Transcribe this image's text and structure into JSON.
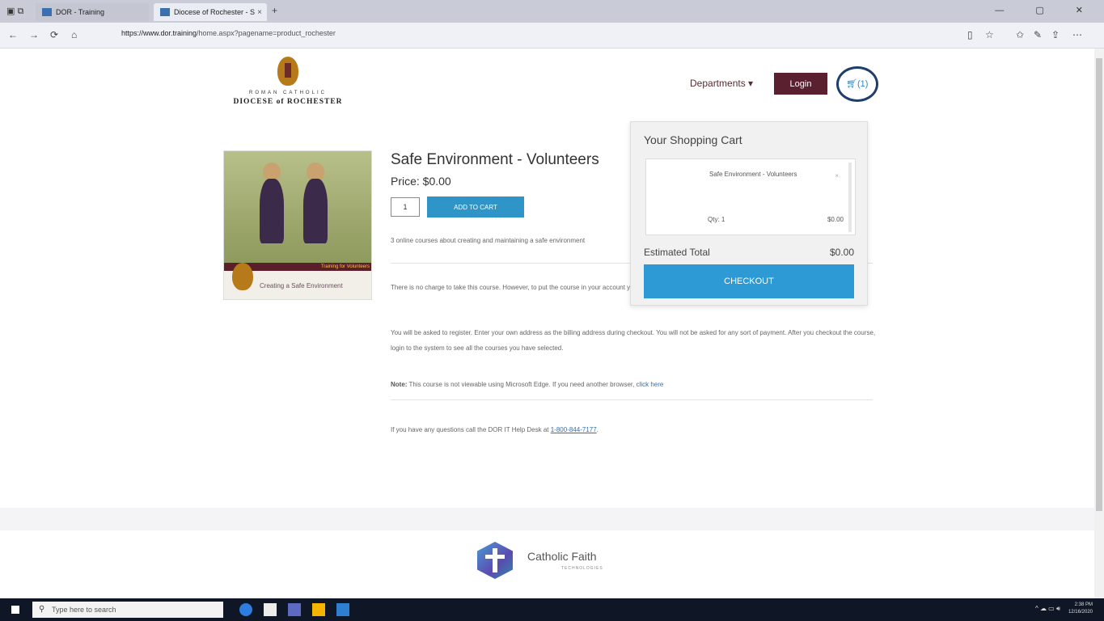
{
  "browser": {
    "tabs": [
      {
        "label": "DOR - Training",
        "active": false
      },
      {
        "label": "Diocese of Rochester - S",
        "active": true
      }
    ],
    "new_tab": "+",
    "url_host": "https://www.dor.training",
    "url_path": "/home.aspx?pagename=product_rochester",
    "nav": {
      "back": "←",
      "forward": "→",
      "refresh": "⟳",
      "home": "⌂"
    },
    "window_controls": "— ▢ ✕"
  },
  "site": {
    "logo_top": "ROMAN CATHOLIC",
    "logo_main": "DIOCESE of ROCHESTER",
    "departments": "Departments ▾",
    "login": "Login",
    "cart_count": "(1)"
  },
  "product": {
    "title": "Safe Environment - Volunteers",
    "price": "Price: $0.00",
    "quantity": "1",
    "add_to_cart": "ADD TO CART",
    "image_band": "Training for Volunteers",
    "image_caption": "Creating a Safe Environment",
    "description": "3 online courses about creating and maintaining a safe environment",
    "para1": "There is no charge to take this course. However, to put the course in your account you will need to add the course to your cart and checkout on the next screen.",
    "para2": "You will be asked to register. Enter your own address as the billing address during checkout. You will not be asked for any sort of payment. After you checkout the course, login to the system to see all the courses you have selected.",
    "note_label": "Note:",
    "note_text": " This course is not viewable using Microsoft Edge. If you need another browser, ",
    "note_link": "click here",
    "help_text": "If you have any questions call the DOR IT Help Desk at ",
    "help_phone": "1-800-844-7177",
    "help_end": "."
  },
  "cart": {
    "title": "Your Shopping Cart",
    "item_name": "Safe Environment - Volunteers",
    "item_remove": "×",
    "item_qty": "Qty: 1",
    "item_price": "$0.00",
    "estimated_label": "Estimated Total",
    "estimated_value": "$0.00",
    "checkout": "CHECKOUT"
  },
  "footer": {
    "brand": "Catholic Faith",
    "brand_sub": "TECHNOLOGIES"
  },
  "taskbar": {
    "search_placeholder": "Type here to search",
    "time": "2:38 PM",
    "date": "12/16/2020"
  },
  "colors": {
    "login_bg": "#5a2030",
    "accent_blue": "#2d9ad6",
    "cart_highlight": "#1f3e6e"
  }
}
